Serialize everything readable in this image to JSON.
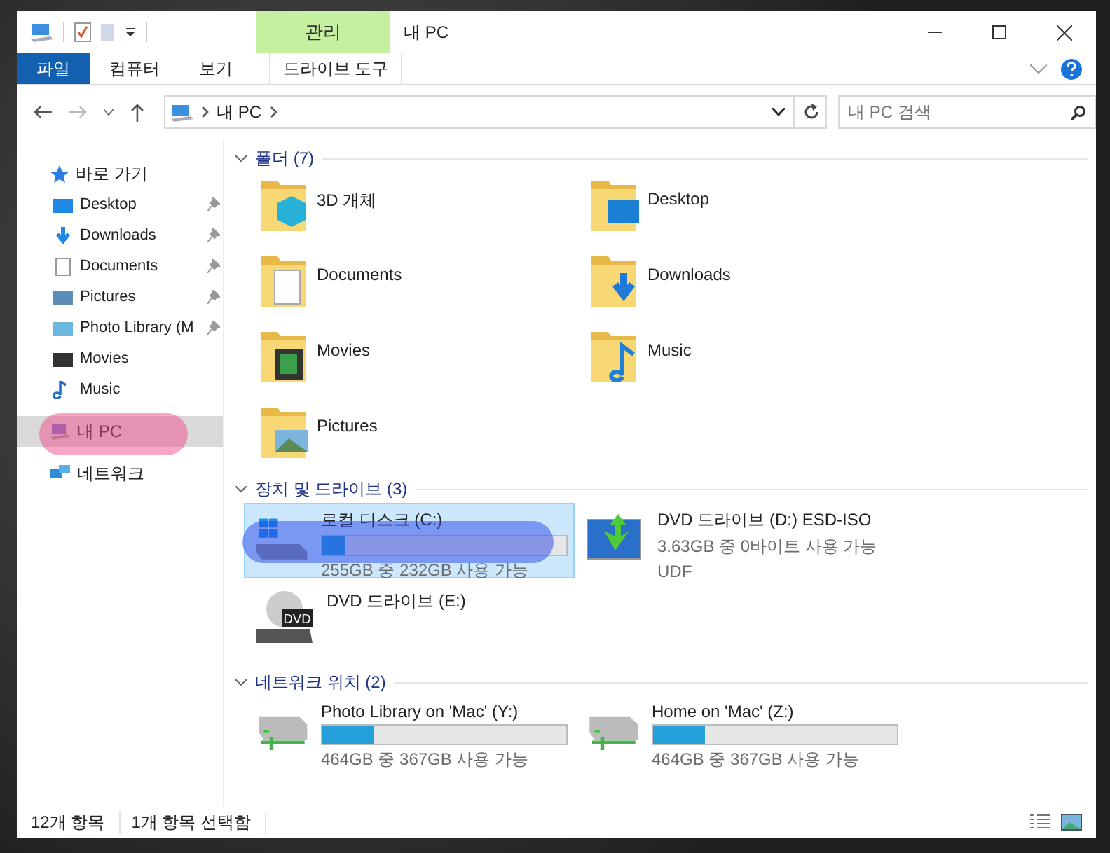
{
  "window": {
    "title": "내 PC"
  },
  "contextual_tab": {
    "label": "관리"
  },
  "ribbon_tabs": [
    {
      "label": "파일",
      "kind": "file",
      "selected": false
    },
    {
      "label": "컴퓨터",
      "kind": "tab",
      "selected": false
    },
    {
      "label": "보기",
      "kind": "tab",
      "selected": false
    },
    {
      "label": "드라이브 도구",
      "kind": "contextual",
      "selected": false
    }
  ],
  "address_bar": {
    "path": [
      "내 PC"
    ]
  },
  "search": {
    "placeholder": "내 PC 검색"
  },
  "sidebar": {
    "items": [
      {
        "label": "바로 가기",
        "selected": false,
        "children": [
          {
            "label": "Desktop",
            "pinned": true
          },
          {
            "label": "Downloads",
            "pinned": true
          },
          {
            "label": "Documents",
            "pinned": true
          },
          {
            "label": "Pictures",
            "pinned": true
          },
          {
            "label": "Photo Library (M",
            "pinned": true
          },
          {
            "label": "Movies",
            "pinned": false
          },
          {
            "label": "Music",
            "pinned": false
          }
        ]
      },
      {
        "label": "내 PC",
        "selected": true
      },
      {
        "label": "네트워크",
        "selected": false
      }
    ]
  },
  "sections": [
    {
      "title": "폴더",
      "count": "(7)",
      "expanded": true,
      "kind": "folders",
      "items": [
        {
          "label": "3D 개체"
        },
        {
          "label": "Desktop"
        },
        {
          "label": "Documents"
        },
        {
          "label": "Downloads"
        },
        {
          "label": "Movies"
        },
        {
          "label": "Music"
        },
        {
          "label": "Pictures"
        }
      ]
    },
    {
      "title": "장치 및 드라이브",
      "count": "(3)",
      "expanded": true,
      "kind": "drives",
      "items": [
        {
          "label": "로컬 디스크 (C:)",
          "kind": "disk",
          "selected": true,
          "level": 0.09,
          "detail": "255GB 중 232GB 사용 가능"
        },
        {
          "label": "DVD 드라이브 (D:) ESD-ISO",
          "kind": "dvd-media",
          "selected": false,
          "detail": "3.63GB 중 0바이트 사용 가능",
          "detail_2": "UDF"
        },
        {
          "label": "DVD 드라이브 (E:)",
          "kind": "dvd",
          "selected": false,
          "icon_text": "DVD"
        }
      ]
    },
    {
      "title": "네트워크 위치",
      "count": "(2)",
      "expanded": true,
      "kind": "drives",
      "items": [
        {
          "label": "Photo Library on 'Mac' (Y:)",
          "kind": "network",
          "selected": false,
          "level": 0.21,
          "detail": "464GB 중 367GB 사용 가능"
        },
        {
          "label": "Home on 'Mac' (Z:)",
          "kind": "network",
          "selected": false,
          "level": 0.21,
          "detail": "464GB 중 367GB 사용 가능"
        }
      ]
    }
  ],
  "status_bar": [
    "12개 항목",
    "1개 항목 선택함"
  ]
}
